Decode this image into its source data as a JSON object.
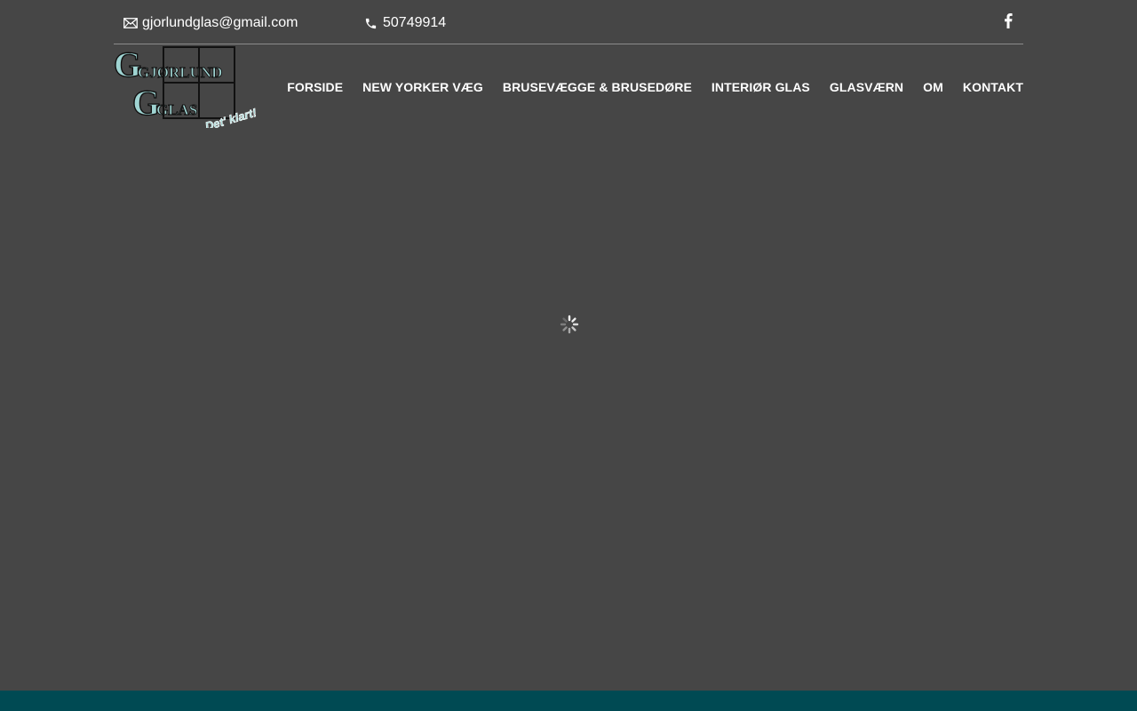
{
  "topbar": {
    "email": "gjorlundglas@gmail.com",
    "phone": "50749914",
    "email_icon": "envelope-icon",
    "phone_icon": "phone-icon",
    "social_icon": "facebook-icon"
  },
  "logo": {
    "line1": "GJØRLUND",
    "line2": "GLAS",
    "tagline": "Det' klart!"
  },
  "nav": {
    "items": [
      {
        "label": "FORSIDE"
      },
      {
        "label": "NEW YORKER VÆG"
      },
      {
        "label": "BRUSEVÆGGE & BRUSEDØRE"
      },
      {
        "label": "INTERIØR GLAS"
      },
      {
        "label": "GLASVÆRN"
      },
      {
        "label": "OM"
      },
      {
        "label": "KONTAKT"
      }
    ]
  },
  "colors": {
    "background": "#464646",
    "footer": "#004a53",
    "logo_accent": "#9fd4d2",
    "text": "#ffffff"
  }
}
